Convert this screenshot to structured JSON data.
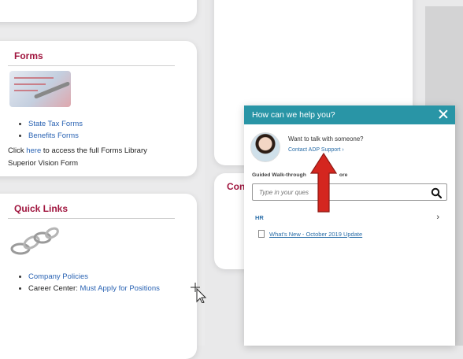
{
  "forms_card": {
    "title": "Forms",
    "links": [
      "State Tax Forms",
      "Benefits Forms"
    ],
    "library_prefix": "Click ",
    "library_link": "here",
    "library_suffix": " to access the full Forms Library",
    "vision_link": "Superior Vision Form"
  },
  "quick_links_card": {
    "title": "Quick Links",
    "items": [
      {
        "link": "Company Policies"
      },
      {
        "prefix": "Career Center: ",
        "link": "Must Apply for Positions"
      }
    ]
  },
  "partial_card": {
    "title": "Con"
  },
  "help_panel": {
    "title": "How can we help you?",
    "talk_heading": "Want to talk with someone?",
    "contact_link": "Contact ADP Support ›",
    "guided_label": "Guided Walk-through",
    "guided_suffix": "ore",
    "search_placeholder": "Type in your ques",
    "section_label": "HR",
    "document_link": "What's New - October 2019 Update"
  },
  "colors": {
    "accent_title": "#a0153e",
    "panel_header": "#2995a6",
    "link": "#2a63b3",
    "arrow_red": "#d4261f"
  }
}
